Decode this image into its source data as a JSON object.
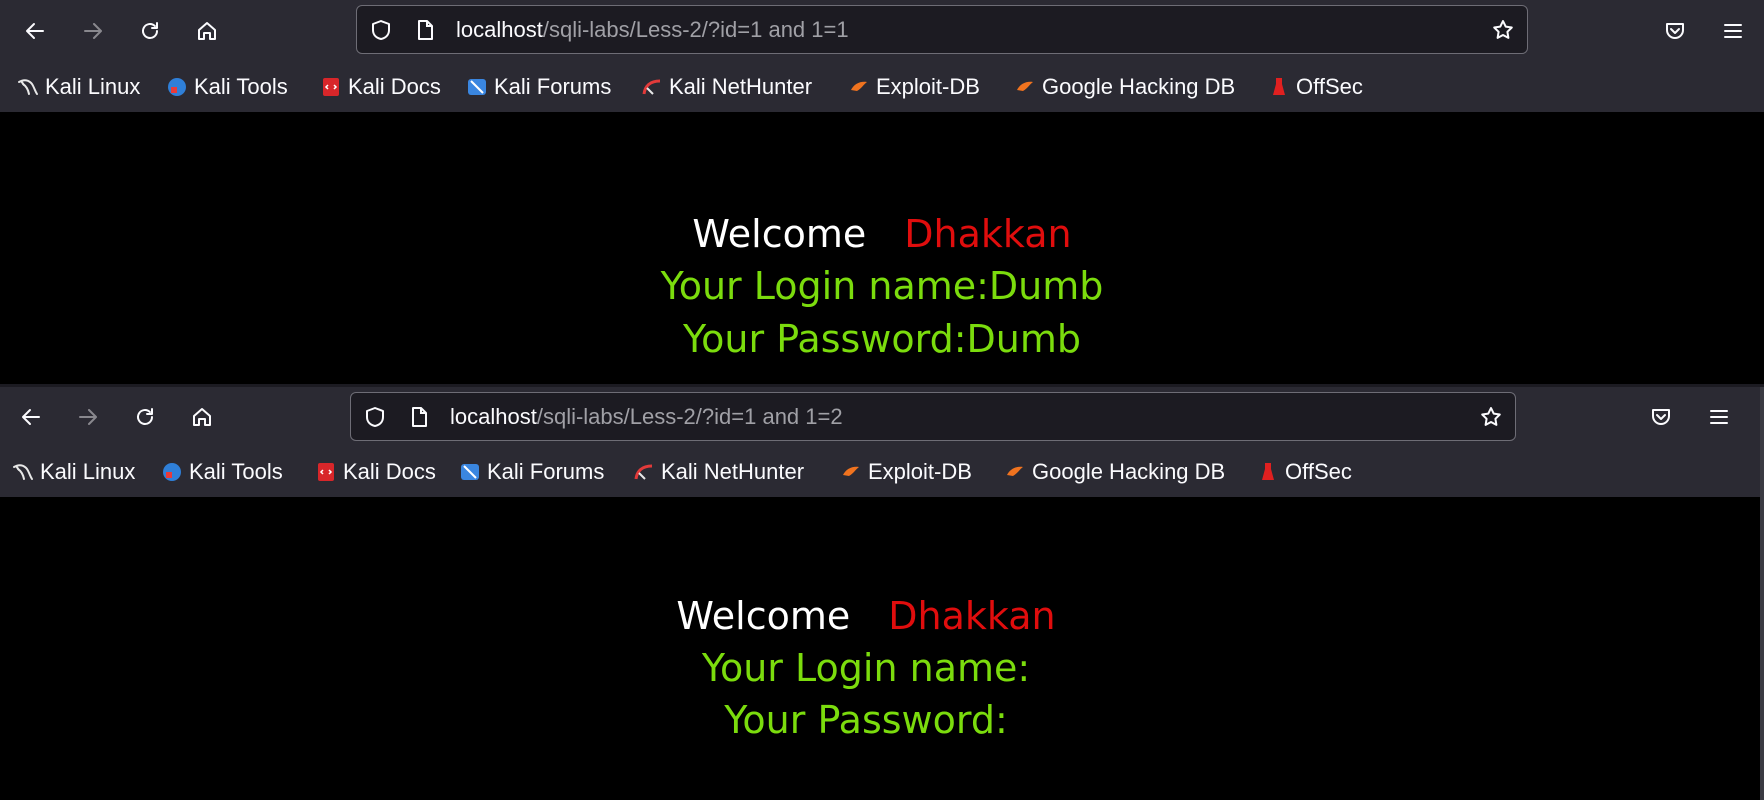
{
  "windows": [
    {
      "url": {
        "host": "localhost",
        "path": "/sqli-labs/Less-2/?id=1 and 1=1"
      },
      "bookmarks": [
        "Kali Linux",
        "Kali Tools",
        "Kali Docs",
        "Kali Forums",
        "Kali NetHunter",
        "Exploit-DB",
        "Google Hacking DB",
        "OffSec"
      ],
      "page": {
        "welcome": "Welcome",
        "user": "Dhakkan",
        "login_line": "Your Login name:Dumb",
        "password_line": "Your Password:Dumb"
      }
    },
    {
      "url": {
        "host": "localhost",
        "path": "/sqli-labs/Less-2/?id=1 and 1=2"
      },
      "bookmarks": [
        "Kali Linux",
        "Kali Tools",
        "Kali Docs",
        "Kali Forums",
        "Kali NetHunter",
        "Exploit-DB",
        "Google Hacking DB",
        "OffSec"
      ],
      "page": {
        "welcome": "Welcome",
        "user": "Dhakkan",
        "login_line": "Your Login name:",
        "password_line": "Your Password:"
      }
    }
  ],
  "colors": {
    "toolbar_bg": "#2b2a33",
    "urlbar_bg": "#1c1b22",
    "page_bg": "#000000",
    "welcome_text": "#ffffff",
    "user_name": "#e00d0d",
    "info_text": "#7bdc0d"
  },
  "icons": {
    "nav": [
      "back-arrow-icon",
      "forward-arrow-icon",
      "reload-icon",
      "home-icon"
    ],
    "urlbar": [
      "tracking-shield-icon",
      "page-info-icon",
      "bookmark-star-icon"
    ],
    "right": [
      "pocket-icon",
      "hamburger-menu-icon"
    ],
    "bookmarks": [
      "kali-dragon-icon",
      "kali-tools-icon",
      "kali-docs-icon",
      "kali-forums-icon",
      "kali-nethunter-icon",
      "exploit-db-icon",
      "ghdb-icon",
      "offsec-icon"
    ]
  }
}
